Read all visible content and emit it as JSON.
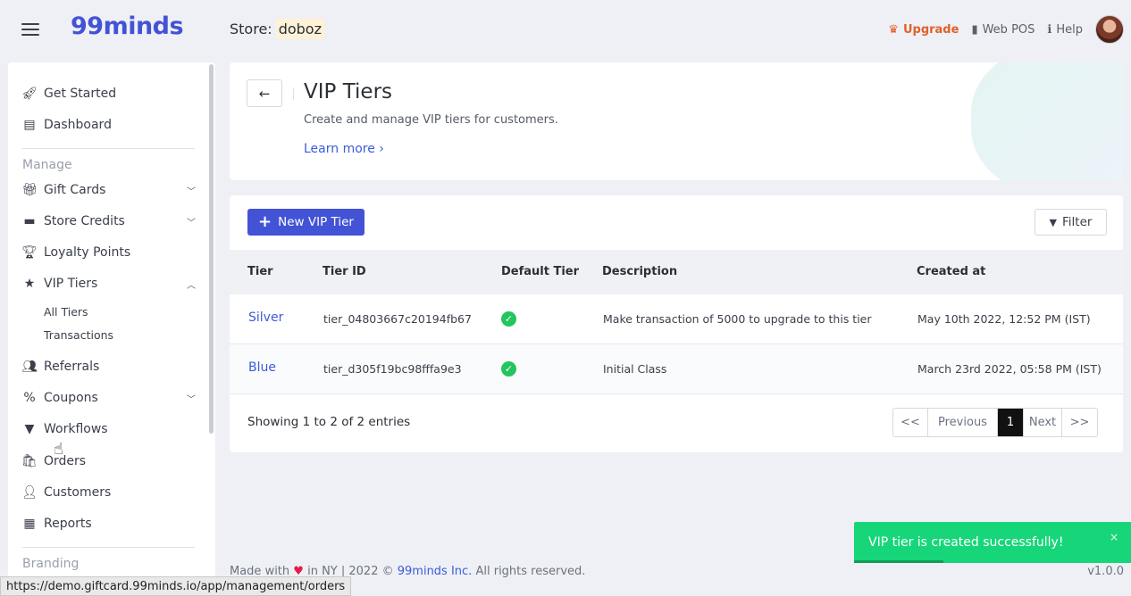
{
  "topbar": {
    "logo": "99minds",
    "store_label": "Store:",
    "store_name": "doboz",
    "upgrade": "Upgrade",
    "web_pos": "Web POS",
    "help": "Help"
  },
  "sidebar": {
    "get_started": "Get Started",
    "dashboard": "Dashboard",
    "manage_section": "Manage",
    "gift_cards": "Gift Cards",
    "store_credits": "Store Credits",
    "loyalty_points": "Loyalty Points",
    "vip_tiers": "VIP Tiers",
    "all_tiers": "All Tiers",
    "transactions": "Transactions",
    "referrals": "Referrals",
    "coupons": "Coupons",
    "workflows": "Workflows",
    "orders": "Orders",
    "customers": "Customers",
    "reports": "Reports",
    "branding_section": "Branding"
  },
  "header": {
    "title": "VIP Tiers",
    "subtitle": "Create and manage VIP tiers for customers.",
    "learn_more": "Learn more ›"
  },
  "table": {
    "new_button": "New VIP Tier",
    "filter_button": "Filter",
    "columns": [
      "Tier",
      "Tier ID",
      "Default Tier",
      "Description",
      "Created at"
    ],
    "rows": [
      {
        "tier": "Silver",
        "tier_id": "tier_04803667c20194fb67",
        "default": true,
        "description": "Make transaction of 5000 to upgrade to this tier",
        "created_at": "May 10th 2022, 12:52 PM (IST)"
      },
      {
        "tier": "Blue",
        "tier_id": "tier_d305f19bc98fffa9e3",
        "default": true,
        "description": "Initial Class",
        "created_at": "March 23rd 2022, 05:58 PM (IST)"
      }
    ],
    "showing": "Showing 1 to 2 of 2 entries",
    "pager": {
      "first": "<<",
      "previous": "Previous",
      "current": "1",
      "next": "Next",
      "last": ">>"
    }
  },
  "footer": {
    "made_with": "Made with",
    "in_ny": "in NY | 2022 ©",
    "company": "99minds Inc.",
    "rights": "All rights reserved.",
    "version": "v1.0.0"
  },
  "toast": {
    "message": "VIP tier is created successfully!",
    "close": "×"
  },
  "status_url": "https://demo.giftcard.99minds.io/app/management/orders",
  "colors": {
    "brand": "#4353d6",
    "upgrade": "#e0612a",
    "success": "#17d67a",
    "link": "#3d5bd9"
  }
}
